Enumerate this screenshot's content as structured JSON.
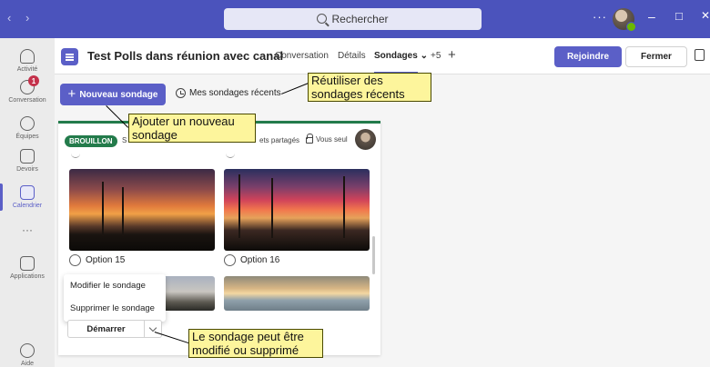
{
  "titlebar": {
    "back_arrow": "‹",
    "forward_arrow": "›",
    "search_placeholder": "Rechercher",
    "more": "···",
    "minimize": "–",
    "maximize": "□",
    "close": "✕"
  },
  "rail": {
    "items": [
      {
        "label": "Activité"
      },
      {
        "label": "Conversation",
        "badge": "1"
      },
      {
        "label": "Équipes"
      },
      {
        "label": "Devoirs"
      },
      {
        "label": "Calendrier"
      },
      {
        "label": "···"
      },
      {
        "label": "Applications"
      },
      {
        "label": "Aide"
      }
    ]
  },
  "header": {
    "channel_title": "Test Polls dans réunion avec canal",
    "tabs": [
      "Conversation",
      "Détails",
      "Sondages ⌄",
      "+5",
      "+"
    ],
    "join_label": "Rejoindre",
    "close_label": "Fermer"
  },
  "toolbar": {
    "new_poll_label": "Nouveau sondage",
    "recent_label": "Mes sondages récents"
  },
  "card": {
    "status_badge": "BROUILLON",
    "status_prefix": "S",
    "shared_label": "ets partagés",
    "visibility_label": "Vous seul",
    "options": [
      "Option 15",
      "Option 16"
    ],
    "menu_items": [
      "Modifier le sondage",
      "Supprimer le sondage"
    ],
    "start_label": "Démarrer"
  },
  "callouts": {
    "recent": "Réutiliser des sondages récents",
    "new": "Ajouter un nouveau sondage",
    "edit": "Le sondage peut être modifié ou supprimé"
  },
  "colors": {
    "titlebar": "#4b53bc",
    "accent": "#5b5fc7",
    "draft_green": "#237b4b",
    "callout_yellow": "#fdf59c"
  }
}
